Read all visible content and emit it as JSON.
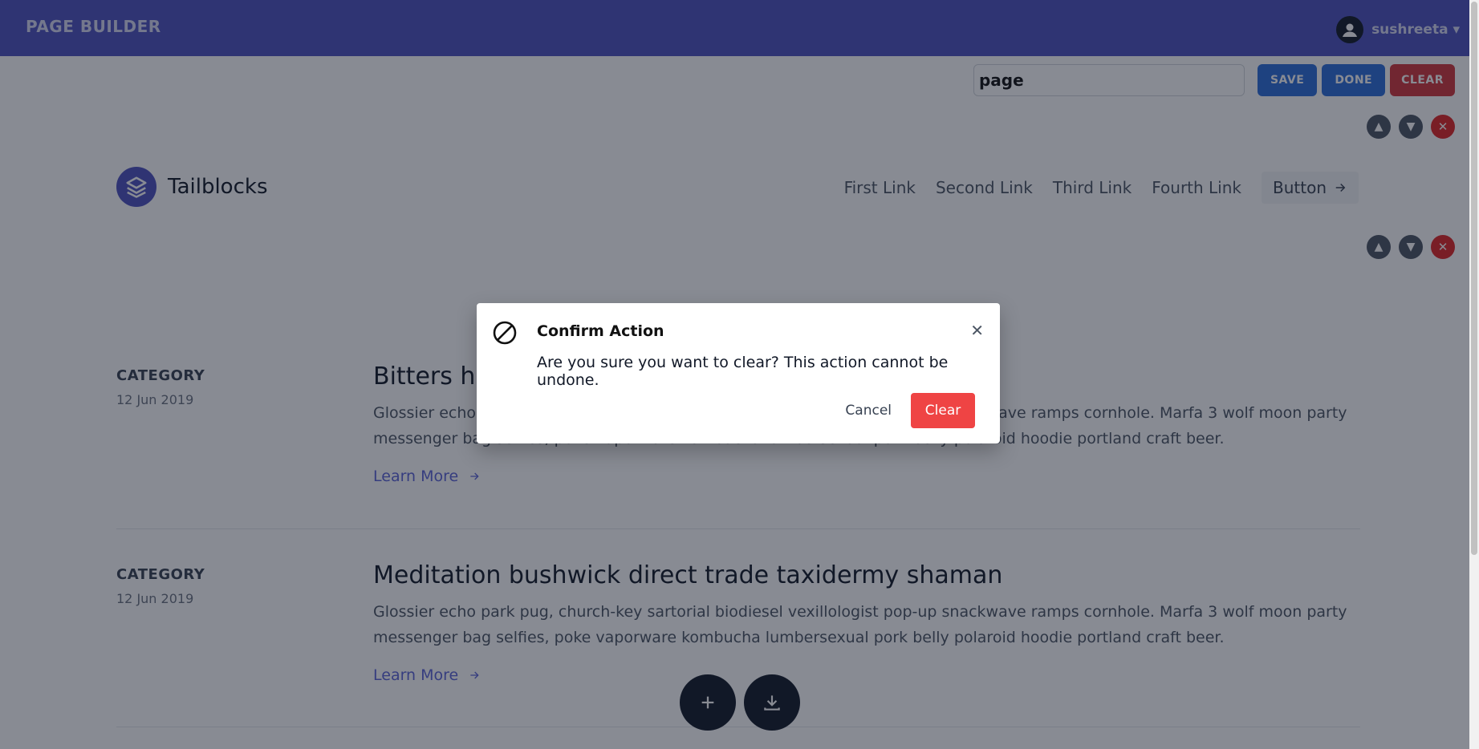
{
  "app": {
    "brand": "PAGE BUILDER",
    "user_name": "sushreeta ▾"
  },
  "toolbar": {
    "page_value": "page",
    "save_label": "SAVE",
    "done_label": "DONE",
    "clear_label": "CLEAR"
  },
  "header_block": {
    "logo_text": "Tailblocks",
    "nav_links": [
      "First Link",
      "Second Link",
      "Third Link",
      "Fourth Link"
    ],
    "button_label": "Button"
  },
  "posts": [
    {
      "category": "CATEGORY",
      "date": "12 Jun 2019",
      "title": "Bitters hashtag waistcoat fashion axe chia unicorn",
      "text": "Glossier echo park pug, church-key sartorial biodiesel vexillologist pop-up snackwave ramps cornhole. Marfa 3 wolf moon party messenger bag selfies, poke vaporware kombucha lumbersexual pork belly polaroid hoodie portland craft beer.",
      "link": "Learn More"
    },
    {
      "category": "CATEGORY",
      "date": "12 Jun 2019",
      "title": "Meditation bushwick direct trade taxidermy shaman",
      "text": "Glossier echo park pug, church-key sartorial biodiesel vexillologist pop-up snackwave ramps cornhole. Marfa 3 wolf moon party messenger bag selfies, poke vaporware kombucha lumbersexual pork belly polaroid hoodie portland craft beer.",
      "link": "Learn More"
    }
  ],
  "modal": {
    "title": "Confirm Action",
    "message": "Are you sure you want to clear? This action cannot be undone.",
    "cancel_label": "Cancel",
    "confirm_label": "Clear"
  },
  "icons": {
    "block_up": "chevron-up-icon",
    "block_down": "chevron-down-icon",
    "block_remove": "close-icon",
    "fab_add": "plus-icon",
    "fab_download": "download-icon",
    "modal": "ban-icon"
  },
  "colors": {
    "accent": "#4c51bf",
    "primary_button": "#2b6cd8",
    "danger": "#d0343a",
    "confirm_button": "#ef4444"
  }
}
